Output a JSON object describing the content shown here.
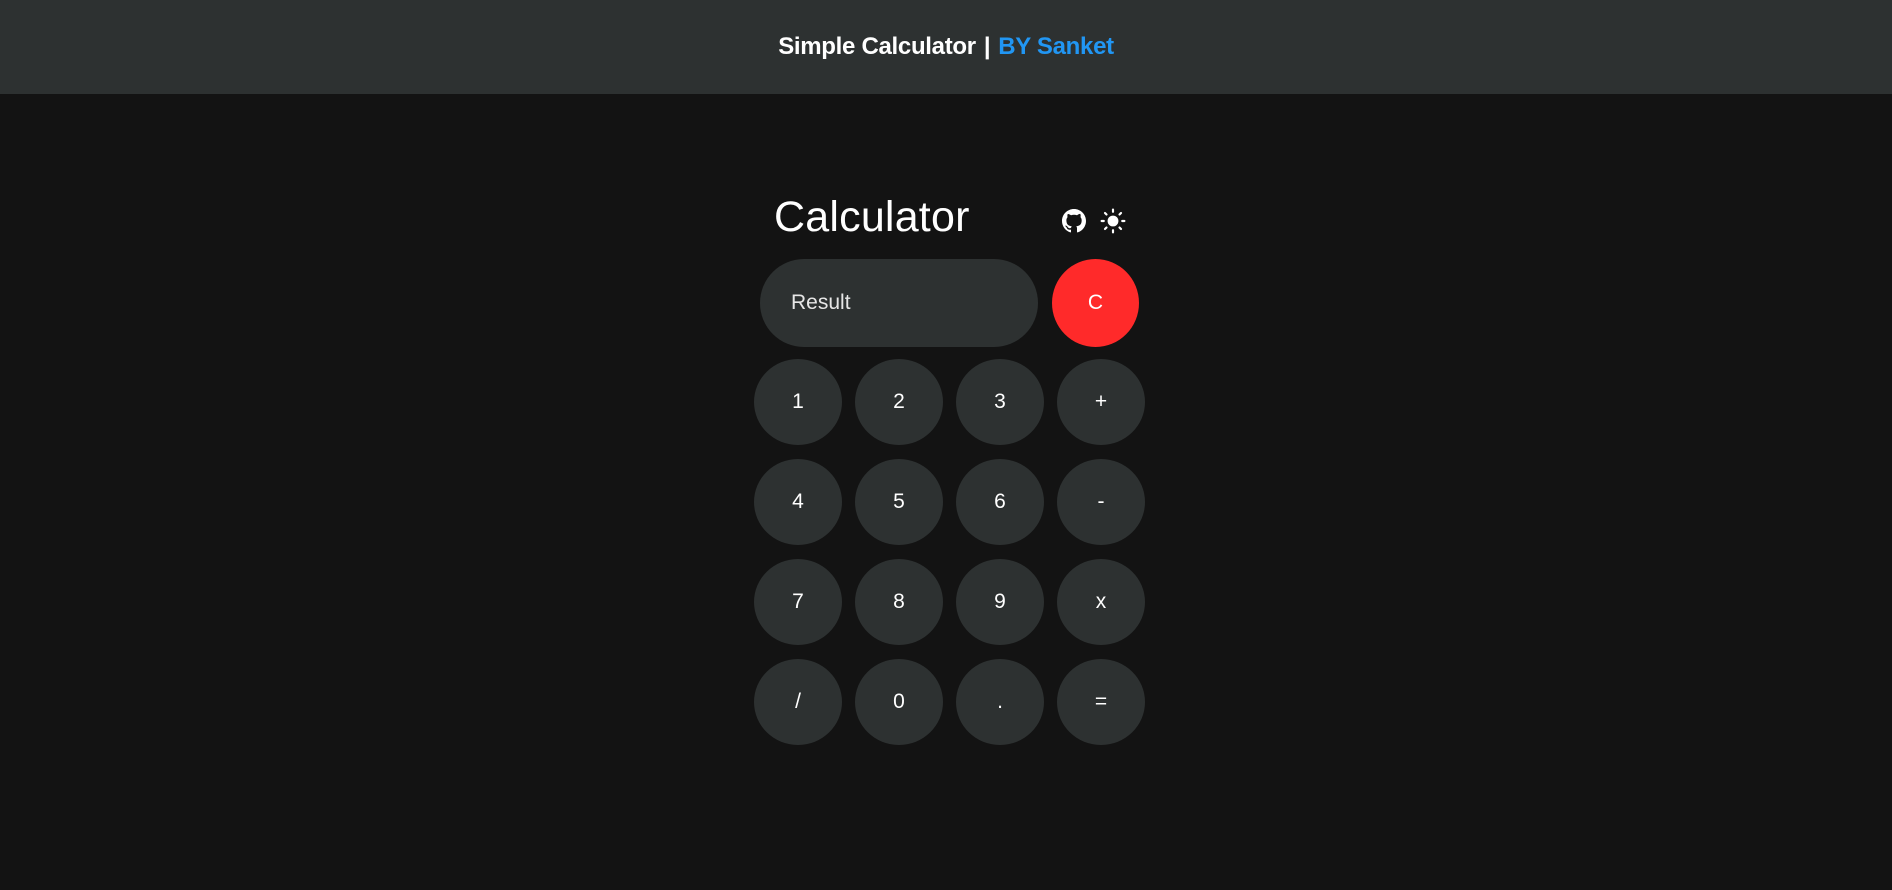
{
  "header": {
    "app_name": "Simple Calculator",
    "separator": "|",
    "author": "BY Sanket"
  },
  "calculator": {
    "title": "Calculator",
    "icons": {
      "github": "github-icon",
      "theme": "sun-icon"
    },
    "display": {
      "value": "",
      "placeholder": "Result"
    },
    "clear_label": "C",
    "keys": [
      {
        "label": "1",
        "name": "key-1"
      },
      {
        "label": "2",
        "name": "key-2"
      },
      {
        "label": "3",
        "name": "key-3"
      },
      {
        "label": "+",
        "name": "key-plus"
      },
      {
        "label": "4",
        "name": "key-4"
      },
      {
        "label": "5",
        "name": "key-5"
      },
      {
        "label": "6",
        "name": "key-6"
      },
      {
        "label": "-",
        "name": "key-minus"
      },
      {
        "label": "7",
        "name": "key-7"
      },
      {
        "label": "8",
        "name": "key-8"
      },
      {
        "label": "9",
        "name": "key-9"
      },
      {
        "label": "x",
        "name": "key-multiply"
      },
      {
        "label": "/",
        "name": "key-divide"
      },
      {
        "label": "0",
        "name": "key-0"
      },
      {
        "label": ".",
        "name": "key-decimal"
      },
      {
        "label": "=",
        "name": "key-equals"
      }
    ]
  },
  "colors": {
    "background": "#131313",
    "surface": "#2d3131",
    "accent": "#2196f3",
    "clear": "#ff2a2a",
    "text": "#ffffff"
  }
}
